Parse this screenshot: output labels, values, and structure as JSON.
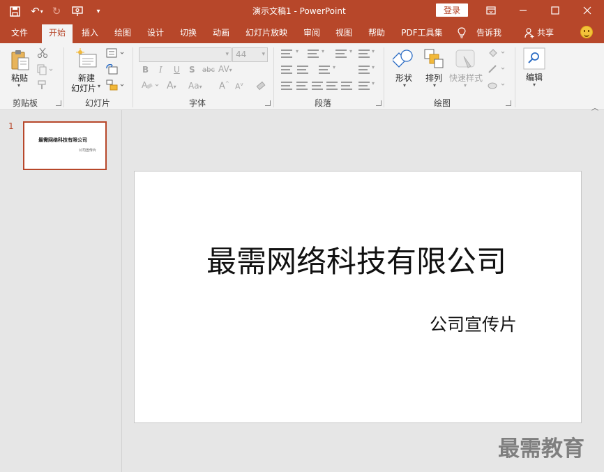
{
  "window": {
    "title": "演示文稿1  -  PowerPoint",
    "login_label": "登录"
  },
  "tabs": [
    {
      "label": "文件"
    },
    {
      "label": "开始"
    },
    {
      "label": "插入"
    },
    {
      "label": "绘图"
    },
    {
      "label": "设计"
    },
    {
      "label": "切换"
    },
    {
      "label": "动画"
    },
    {
      "label": "幻灯片放映"
    },
    {
      "label": "审阅"
    },
    {
      "label": "视图"
    },
    {
      "label": "帮助"
    },
    {
      "label": "PDF工具集"
    },
    {
      "label": "告诉我"
    },
    {
      "label": "共享"
    }
  ],
  "ribbon": {
    "clipboard": {
      "label": "剪贴板",
      "paste": "粘贴"
    },
    "slides": {
      "label": "幻灯片",
      "new_slide_1": "新建",
      "new_slide_2": "幻灯片"
    },
    "font": {
      "label": "字体",
      "font_name": "",
      "font_size": "44"
    },
    "paragraph": {
      "label": "段落"
    },
    "drawing": {
      "label": "绘图",
      "shapes": "形状",
      "arrange": "排列",
      "quick_styles": "快速样式"
    },
    "editing": {
      "label": "编辑"
    }
  },
  "slides_pane": {
    "slide_number": "1",
    "thumb_title": "最需网络科技有限公司",
    "thumb_subtitle": "公司宣传片"
  },
  "slide": {
    "title": "最需网络科技有限公司",
    "subtitle": "公司宣传片"
  },
  "watermark": "最需教育",
  "colors": {
    "accent": "#b7472a",
    "ribbon_bg": "#f3f3f3",
    "workspace_bg": "#e6e6e6"
  }
}
